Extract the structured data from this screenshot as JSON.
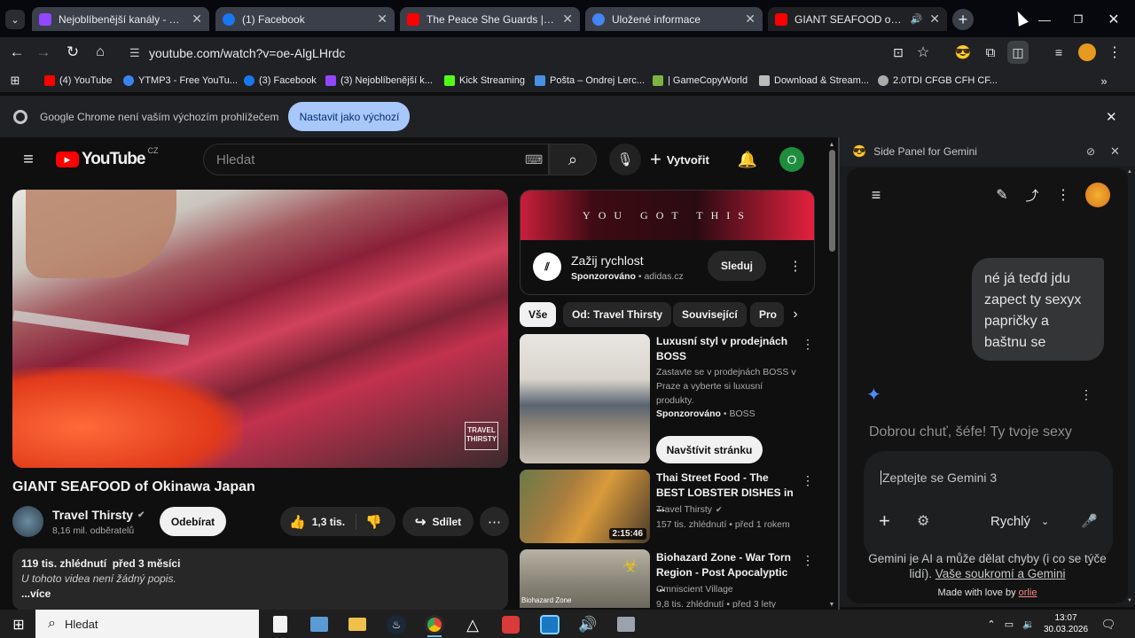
{
  "browser": {
    "tabs": [
      {
        "title": "Nejoblíbenější kanály - Twitch",
        "color": "#9147ff"
      },
      {
        "title": "(1) Facebook",
        "color": "#1877f2"
      },
      {
        "title": "The Peace She Guards | Ambien",
        "color": "#ff0000"
      },
      {
        "title": "Uložené informace",
        "color": "#4285f4"
      },
      {
        "title": "GIANT SEAFOOD of Okinaw",
        "color": "#ff0000"
      }
    ],
    "url": "youtube.com/watch?v=oe-AlgLHrdc",
    "bookmarks": [
      {
        "label": "(4) YouTube",
        "color": "#ff0000"
      },
      {
        "label": "YTMP3 - Free YouTu...",
        "color": "#3b82f6"
      },
      {
        "label": "(3) Facebook",
        "color": "#1877f2"
      },
      {
        "label": "(3) Nejoblíbenější k...",
        "color": "#9147ff"
      },
      {
        "label": "Kick Streaming",
        "color": "#53fc18"
      },
      {
        "label": "Pošta – Ondrej Lerc...",
        "color": "#4a90e2"
      },
      {
        "label": "| GameCopyWorld",
        "color": "#7cb342"
      },
      {
        "label": "Download & Stream...",
        "color": "#bbbbbb"
      },
      {
        "label": "2.0TDI CFGB CFH CF...",
        "color": "#aaaaaa"
      }
    ],
    "infobar": {
      "text": "Google Chrome není vaším výchozím prohlížečem",
      "button": "Nastavit jako výchozí"
    }
  },
  "youtube": {
    "logo": "YouTube",
    "country": "CZ",
    "search_placeholder": "Hledat",
    "create_label": "Vytvořit",
    "avatar_letter": "O",
    "watermark": "TRAVEL\nTHIRSTY",
    "video_title": "GIANT SEAFOOD of Okinawa Japan",
    "channel": "Travel Thirsty",
    "subscribers": "8,16 mil. odběratelů",
    "subscribe_label": "Odebírat",
    "likes": "1,3 tis.",
    "share_label": "Sdílet",
    "description": {
      "stats": "119 tis. zhlédnutí  před 3 měsíci",
      "text": "U tohoto videa není žádný popis.",
      "more": "...více"
    },
    "ad": {
      "banner_text": "YOU GOT THIS",
      "title": "Zažij rychlost",
      "sponsored": "Sponzorováno",
      "domain": "adidas.cz",
      "button": "Sleduj"
    },
    "chips": [
      "Vše",
      "Od: Travel Thirsty",
      "Související",
      "Pro"
    ],
    "recommendations": [
      {
        "title": "Luxusní styl v prodejnách BOSS",
        "desc": "Zastavte se v prodejnách BOSS v Praze a vyberte si luxusní produkty.",
        "sponsored": "Sponzorováno",
        "channel": "BOSS",
        "cta": "Navštívit stránku"
      },
      {
        "title": "Thai Street Food - The BEST LOBSTER DISHES in ...",
        "channel": "Travel Thirsty",
        "stats": "157 tis. zhlédnutí • před 1 rokem",
        "duration": "2:15:46"
      },
      {
        "title": "Biohazard Zone - War Torn Region - Post Apocalyptic ...",
        "channel": "Omniscient Village",
        "stats": "9,8 tis. zhlédnutí • před 3 lety",
        "thumb_label": "Biohazard Zone"
      }
    ]
  },
  "gemini": {
    "panel_title": "Side Panel for Gemini",
    "user_message": "né já teďd jdu zapect ty sexyx papričky a baštnu se",
    "response": "Dobrou chuť, šéfe! Ty tvoje sexy",
    "input_placeholder": "Zeptejte se Gemini 3",
    "mode": "Rychlý",
    "disclaimer": "Gemini je AI a může dělat chyby (i co se týče lidí).",
    "privacy_link": "Vaše soukromí a Gemini",
    "made_with": "Made with love by",
    "author": "orlie"
  },
  "taskbar": {
    "search": "Hledat",
    "time": "13:07",
    "date": "30.03.2026"
  }
}
